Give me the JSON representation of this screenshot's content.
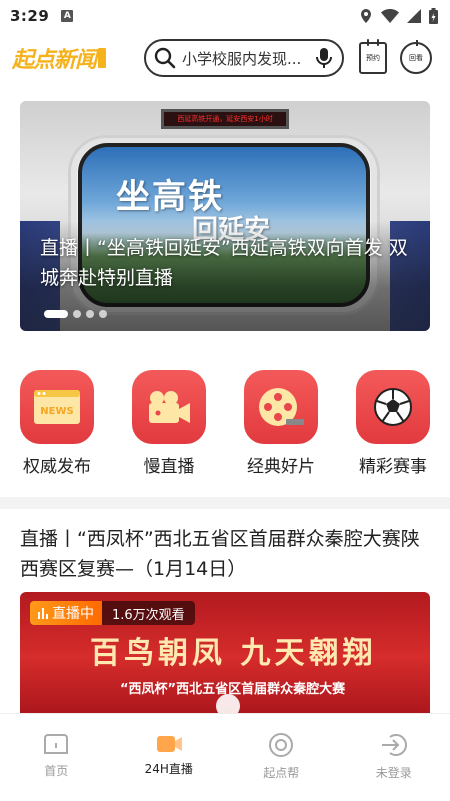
{
  "status_bar": {
    "time": "3:29",
    "notif_letter": "A"
  },
  "header": {
    "logo_text": "起点新闻",
    "search_placeholder": "小学校服内发现...",
    "reserve_label": "预约",
    "review_label": "回看"
  },
  "banner": {
    "led_text": "西延高铁开通，延安西安1小时",
    "scene_text_1": "坐高铁",
    "scene_text_2": "回延安",
    "title": "直播丨“坐高铁回延安”西延高铁双向首发 双城奔赴特别直播",
    "dots": 4,
    "active_dot": 0
  },
  "categories": [
    {
      "label": "权威发布",
      "icon": "news-icon"
    },
    {
      "label": "慢直播",
      "icon": "video-camera-icon"
    },
    {
      "label": "经典好片",
      "icon": "film-reel-icon"
    },
    {
      "label": "精彩赛事",
      "icon": "soccer-ball-icon"
    }
  ],
  "news": {
    "title": "直播丨“西凤杯”西北五省区首届群众秦腔大赛陕西赛区复赛—（1月14日）",
    "live_label": "直播中",
    "viewers": "1.6万次观看",
    "image_calli": "百鸟朝凤 九天翱翔",
    "image_sub": "“西凤杯”西北五省区首届群众秦腔大赛"
  },
  "tabbar": [
    {
      "label": "首页",
      "icon": "home-icon"
    },
    {
      "label": "24H直播",
      "icon": "live-icon"
    },
    {
      "label": "起点帮",
      "icon": "help-icon"
    },
    {
      "label": "未登录",
      "icon": "login-icon"
    }
  ],
  "colors": {
    "accent": "#f6b21c",
    "category_red": "#e8464a",
    "live_orange": "#ff8a1a"
  }
}
